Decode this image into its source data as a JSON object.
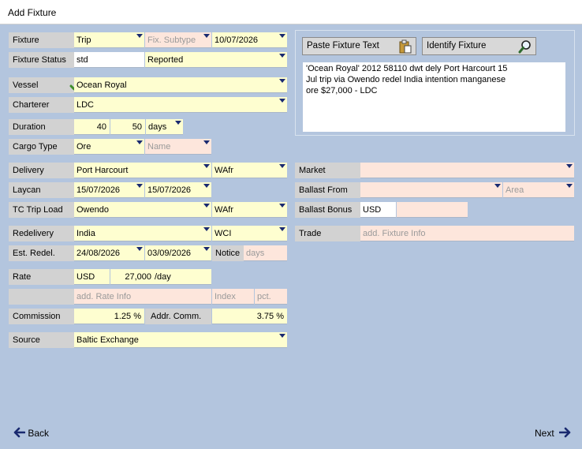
{
  "window": {
    "title": "Add Fixture"
  },
  "rows": {
    "fixture": {
      "label": "Fixture",
      "type": "Trip",
      "subtype_placeholder": "Fix. Subtype",
      "date": "10/07/2026"
    },
    "fixture_status": {
      "label": "Fixture Status",
      "code": "std",
      "status": "Reported"
    },
    "vessel": {
      "label": "Vessel",
      "value": "Ocean Royal"
    },
    "charterer": {
      "label": "Charterer",
      "value": "LDC"
    },
    "duration": {
      "label": "Duration",
      "min": "40",
      "max": "50",
      "unit": "days"
    },
    "cargo_type": {
      "label": "Cargo Type",
      "value": "Ore",
      "name_placeholder": "Name"
    },
    "delivery": {
      "label": "Delivery",
      "port": "Port Harcourt",
      "area": "WAfr"
    },
    "laycan": {
      "label": "Laycan",
      "from": "15/07/2026",
      "to": "15/07/2026"
    },
    "tc_trip_load": {
      "label": "TC Trip Load",
      "port": "Owendo",
      "area": "WAfr"
    },
    "redelivery": {
      "label": "Redelivery",
      "port": "India",
      "area": "WCI"
    },
    "est_redel": {
      "label": "Est. Redel.",
      "from": "24/08/2026",
      "to": "03/09/2026",
      "notice_label": "Notice",
      "notice_placeholder": "days"
    },
    "rate": {
      "label": "Rate",
      "currency": "USD",
      "amount": "27,000",
      "per": "/day"
    },
    "rate_info": {
      "placeholder": "add. Rate Info",
      "index_placeholder": "Index",
      "pct_placeholder": "pct."
    },
    "commission": {
      "label": "Commission",
      "value": "1.25 %",
      "addr_label": "Addr. Comm.",
      "addr_value": "3.75 %"
    },
    "source": {
      "label": "Source",
      "value": "Baltic Exchange"
    }
  },
  "right": {
    "market": {
      "label": "Market"
    },
    "ballast_from": {
      "label": "Ballast From",
      "area_placeholder": "Area"
    },
    "ballast_bonus": {
      "label": "Ballast Bonus",
      "currency": "USD"
    },
    "trade": {
      "label": "Trade",
      "placeholder": "add. Fixture Info"
    }
  },
  "panel": {
    "paste_label": "Paste Fixture Text",
    "identify_label": "Identify Fixture",
    "text": "'Ocean Royal' 2012 58110 dwt dely Port Harcourt 15\nJul trip via Owendo redel India intention manganese\nore $27,000 - LDC"
  },
  "nav": {
    "back": "Back",
    "next": "Next"
  },
  "icons": {
    "paste": "clipboard-icon",
    "identify": "magnifier-icon",
    "check": "check-icon",
    "back": "arrow-left-icon",
    "next": "arrow-right-icon"
  },
  "colors": {
    "background": "#b3c5de",
    "required": "#fefed0",
    "optional": "#fde6dc",
    "label": "#d2d2d2",
    "accent": "#1a2a70"
  }
}
